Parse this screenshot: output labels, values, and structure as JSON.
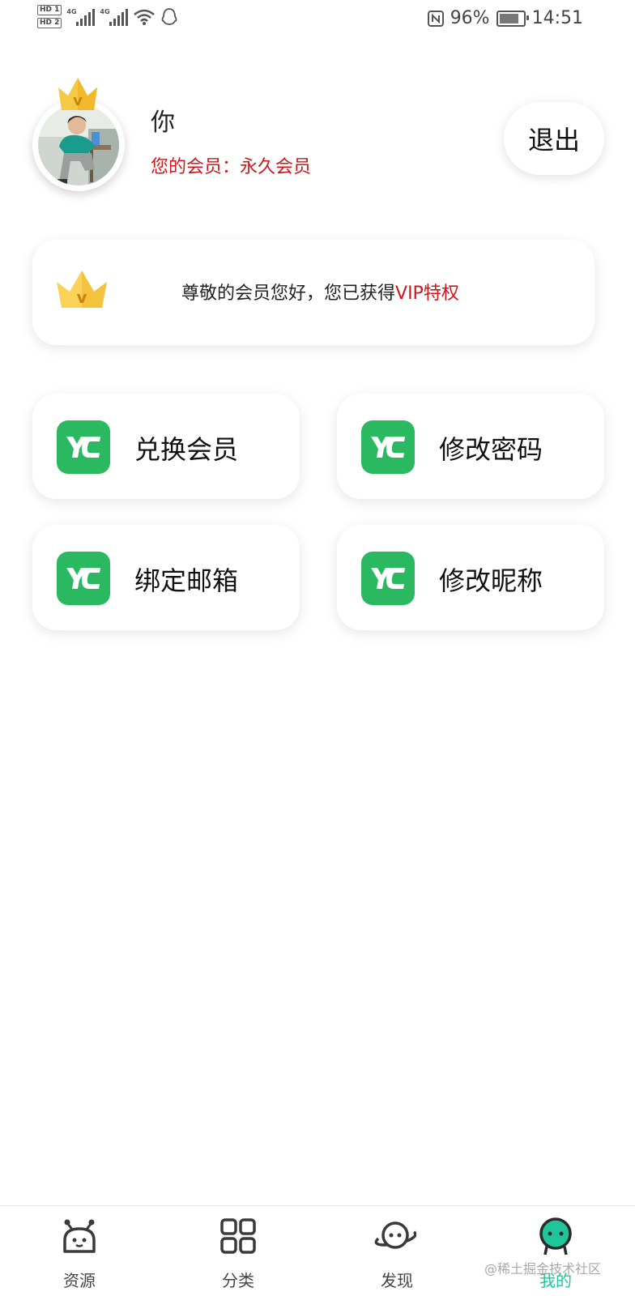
{
  "status_bar": {
    "hd1": "HD 1",
    "hd2": "HD 2",
    "net1": "4G",
    "net2": "4G",
    "battery_pct": "96%",
    "battery_level": 0.96,
    "time": "14:51",
    "icons": [
      "wifi-icon",
      "qq-icon",
      "nfc-icon",
      "battery-icon"
    ]
  },
  "profile": {
    "name": "你",
    "membership": "您的会员：永久会员",
    "logout_label": "退出",
    "crown_letter": "v"
  },
  "vip_card": {
    "text": "尊敬的会员您好，您已获得",
    "highlight": "VIP特权",
    "crown_letter": "v"
  },
  "actions": [
    {
      "label": "兑换会员",
      "icon": "yc-logo-icon"
    },
    {
      "label": "修改密码",
      "icon": "yc-logo-icon"
    },
    {
      "label": "绑定邮箱",
      "icon": "yc-logo-icon"
    },
    {
      "label": "修改昵称",
      "icon": "yc-logo-icon"
    }
  ],
  "bottom_nav": {
    "items": [
      {
        "label": "资源",
        "icon": "robot-icon",
        "active": false
      },
      {
        "label": "分类",
        "icon": "grid-icon",
        "active": false
      },
      {
        "label": "发现",
        "icon": "planet-icon",
        "active": false
      },
      {
        "label": "我的",
        "icon": "profile-icon",
        "active": true
      }
    ]
  },
  "watermark": "@稀土掘金技术社区",
  "colors": {
    "accent_red": "#d0161c",
    "brand_green": "#2ab860",
    "active_tab": "#1fc69c",
    "crown_gold": "#f6c945"
  }
}
